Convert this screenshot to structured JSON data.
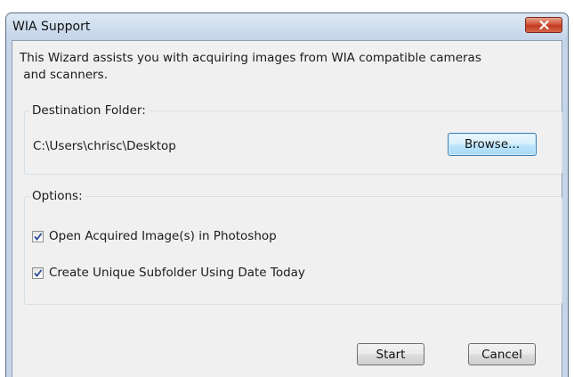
{
  "window": {
    "title": "WIA Support"
  },
  "intro": {
    "line1": "This Wizard assists you with acquiring images from WIA compatible cameras",
    "line2": " and scanners."
  },
  "destination": {
    "legend": "Destination Folder:",
    "path": "C:\\Users\\chrisc\\Desktop",
    "browse_label": "Browse..."
  },
  "options": {
    "legend": "Options:",
    "items": [
      {
        "label": "Open Acquired Image(s) in Photoshop",
        "checked": true
      },
      {
        "label": "Create Unique Subfolder Using Date Today",
        "checked": true
      }
    ]
  },
  "buttons": {
    "start_label": "Start",
    "cancel_label": "Cancel"
  },
  "icons": {
    "close": "close-icon",
    "checkmark": "checkmark-icon"
  },
  "colors": {
    "close_button": "#c23a20",
    "title_bar": "#c6d6e8",
    "client_bg": "#f0f0f0",
    "default_button_border": "#3c7fb1"
  }
}
